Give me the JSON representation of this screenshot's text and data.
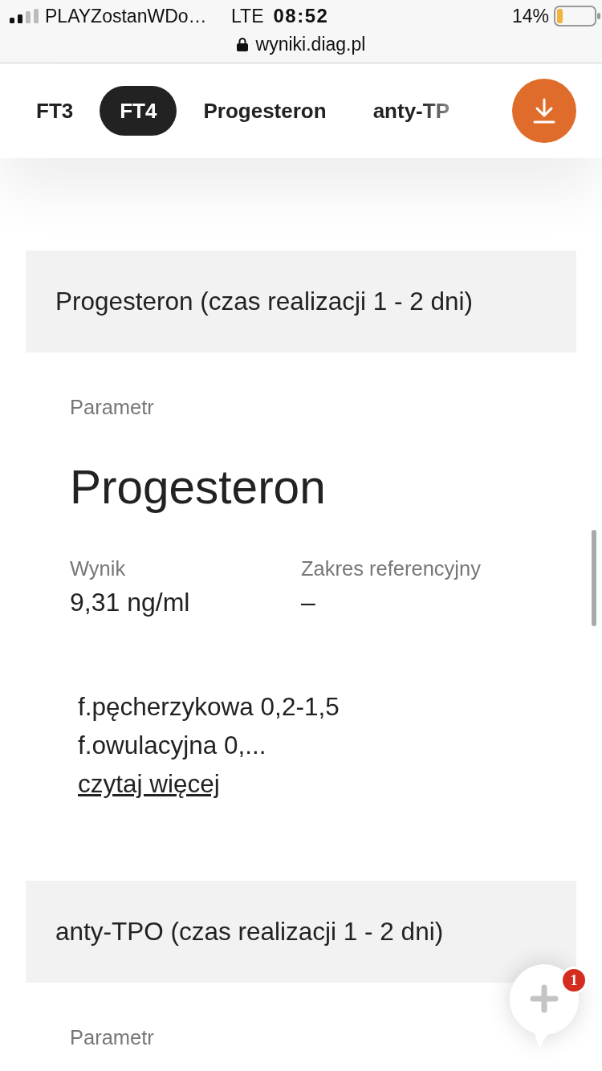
{
  "status_bar": {
    "carrier": "PLAYZostanWDo…",
    "network": "LTE",
    "time": "08:52",
    "battery": "14%"
  },
  "address_bar": {
    "url": "wyniki.diag.pl"
  },
  "tabs": [
    {
      "label": "FT3",
      "selected": false
    },
    {
      "label": "FT4",
      "selected": true
    },
    {
      "label": "Progesteron",
      "selected": false
    },
    {
      "label": "anty-TP",
      "selected": false
    }
  ],
  "sections": [
    {
      "title": "Progesteron (czas realizacji 1 - 2 dni)",
      "parameter_label": "Parametr",
      "parameter": "Progesteron",
      "result_label": "Wynik",
      "result": "9,31 ng/ml",
      "range_label": "Zakres referencyjny",
      "range": "–",
      "notes": [
        "f.pęcherzykowa 0,2-1,5",
        "f.owulacyjna 0,..."
      ],
      "more_link": "czytaj więcej"
    },
    {
      "title": "anty-TPO (czas realizacji 1 - 2 dni)",
      "parameter_label": "Parametr"
    }
  ],
  "chat_button": {
    "badge": "1"
  }
}
